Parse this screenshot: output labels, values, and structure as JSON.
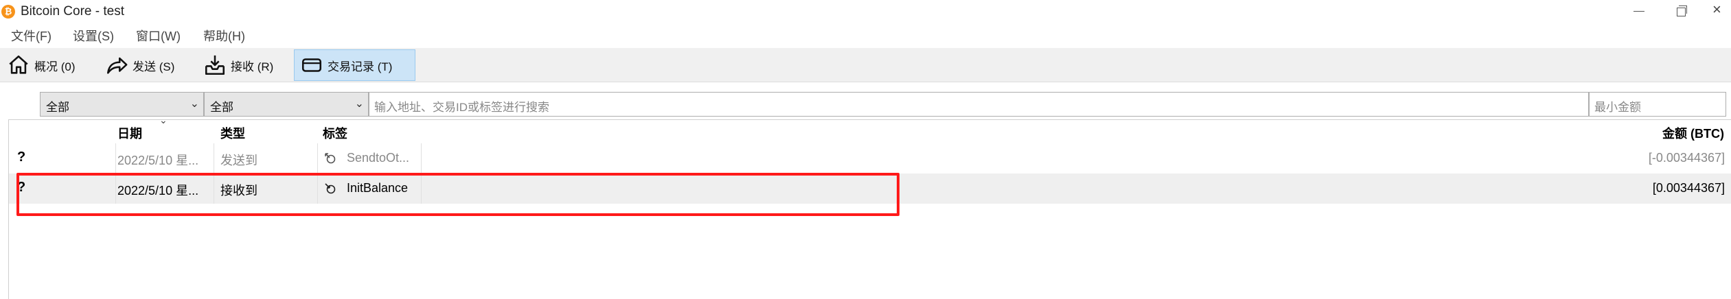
{
  "window": {
    "title": "Bitcoin Core - test",
    "app_icon_glyph": "₿",
    "close_glyph": "×"
  },
  "menu": [
    "文件(F)",
    "设置(S)",
    "窗口(W)",
    "帮助(H)"
  ],
  "toolbar": {
    "tabs": [
      {
        "label": "概况 (0)",
        "icon": "home-icon"
      },
      {
        "label": "发送 (S)",
        "icon": "send-arrow-icon"
      },
      {
        "label": "接收 (R)",
        "icon": "receive-inbox-icon"
      },
      {
        "label": "交易记录 (T)",
        "icon": "wallet-card-icon",
        "active": true
      }
    ]
  },
  "filters": {
    "date_filter": "全部",
    "type_filter": "全部",
    "search_placeholder": "输入地址、交易ID或标签进行搜索",
    "min_amount_placeholder": "最小金额",
    "dropdown_glyph": "⌄"
  },
  "table": {
    "headers": {
      "date": "日期",
      "type": "类型",
      "label": "标签",
      "amount": "金额 (BTC)"
    },
    "sort_glyph": "⌄",
    "rows": [
      {
        "status": "?",
        "date": "2022/5/10 星...",
        "type": "发送到",
        "label": "SendtoOt...",
        "amount": "[-0.00344367]",
        "faded": true
      },
      {
        "status": "?",
        "date": "2022/5/10 星...",
        "type": "接收到",
        "label": "InitBalance",
        "amount": "[0.00344367]",
        "faded": false
      }
    ]
  },
  "colors": {
    "accent_tab": "#cce4f7",
    "highlight_box": "#ff1a1a",
    "bitcoin_orange": "#f7931a"
  }
}
